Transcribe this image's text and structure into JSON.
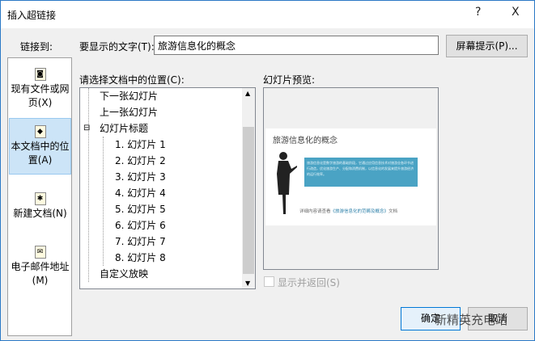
{
  "title": "插入超链接",
  "help_label": "?",
  "close_label": "X",
  "link_to_label": "链接到:",
  "display_text_label": "要显示的文字(T):",
  "display_text_value": "旅游信息化的概念",
  "screentip_label": "屏幕提示(P)...",
  "sidebar": {
    "items": [
      {
        "label": "现有文件或网页(X)",
        "icon": "web-file-icon"
      },
      {
        "label": "本文档中的位置(A)",
        "icon": "document-place-icon",
        "selected": true
      },
      {
        "label": "新建文档(N)",
        "icon": "new-document-icon"
      },
      {
        "label": "电子邮件地址(M)",
        "icon": "email-icon"
      }
    ]
  },
  "location_label": "请选择文档中的位置(C):",
  "tree": {
    "items": [
      "下一张幻灯片",
      "上一张幻灯片",
      "幻灯片标题",
      "1. 幻灯片 1",
      "2. 幻灯片 2",
      "3. 幻灯片 3",
      "4. 幻灯片 4",
      "5. 幻灯片 5",
      "6. 幻灯片 6",
      "7. 幻灯片 7",
      "8. 幻灯片 8",
      "自定义放映"
    ],
    "expander": "⊟"
  },
  "preview_label": "幻灯片预览:",
  "slide": {
    "title": "旅游信息化的概念",
    "body": "旅游信息化是数字旅游的基础阶段，它通过应用信息技术对旅游业各环节进行改造，优化旅游生产、分配和消费机制，以信息化的发展来提升旅游经济的运行效率。",
    "footer_prefix": "详细内容请查看",
    "footer_link": "《旅游信息化的范畴及概念》",
    "footer_suffix": "文档",
    "accent": "#4aa3c4"
  },
  "show_return_label": "显示并返回(S)",
  "ok_label": "确定",
  "cancel_label": "取消",
  "watermark": "新精英充电站"
}
